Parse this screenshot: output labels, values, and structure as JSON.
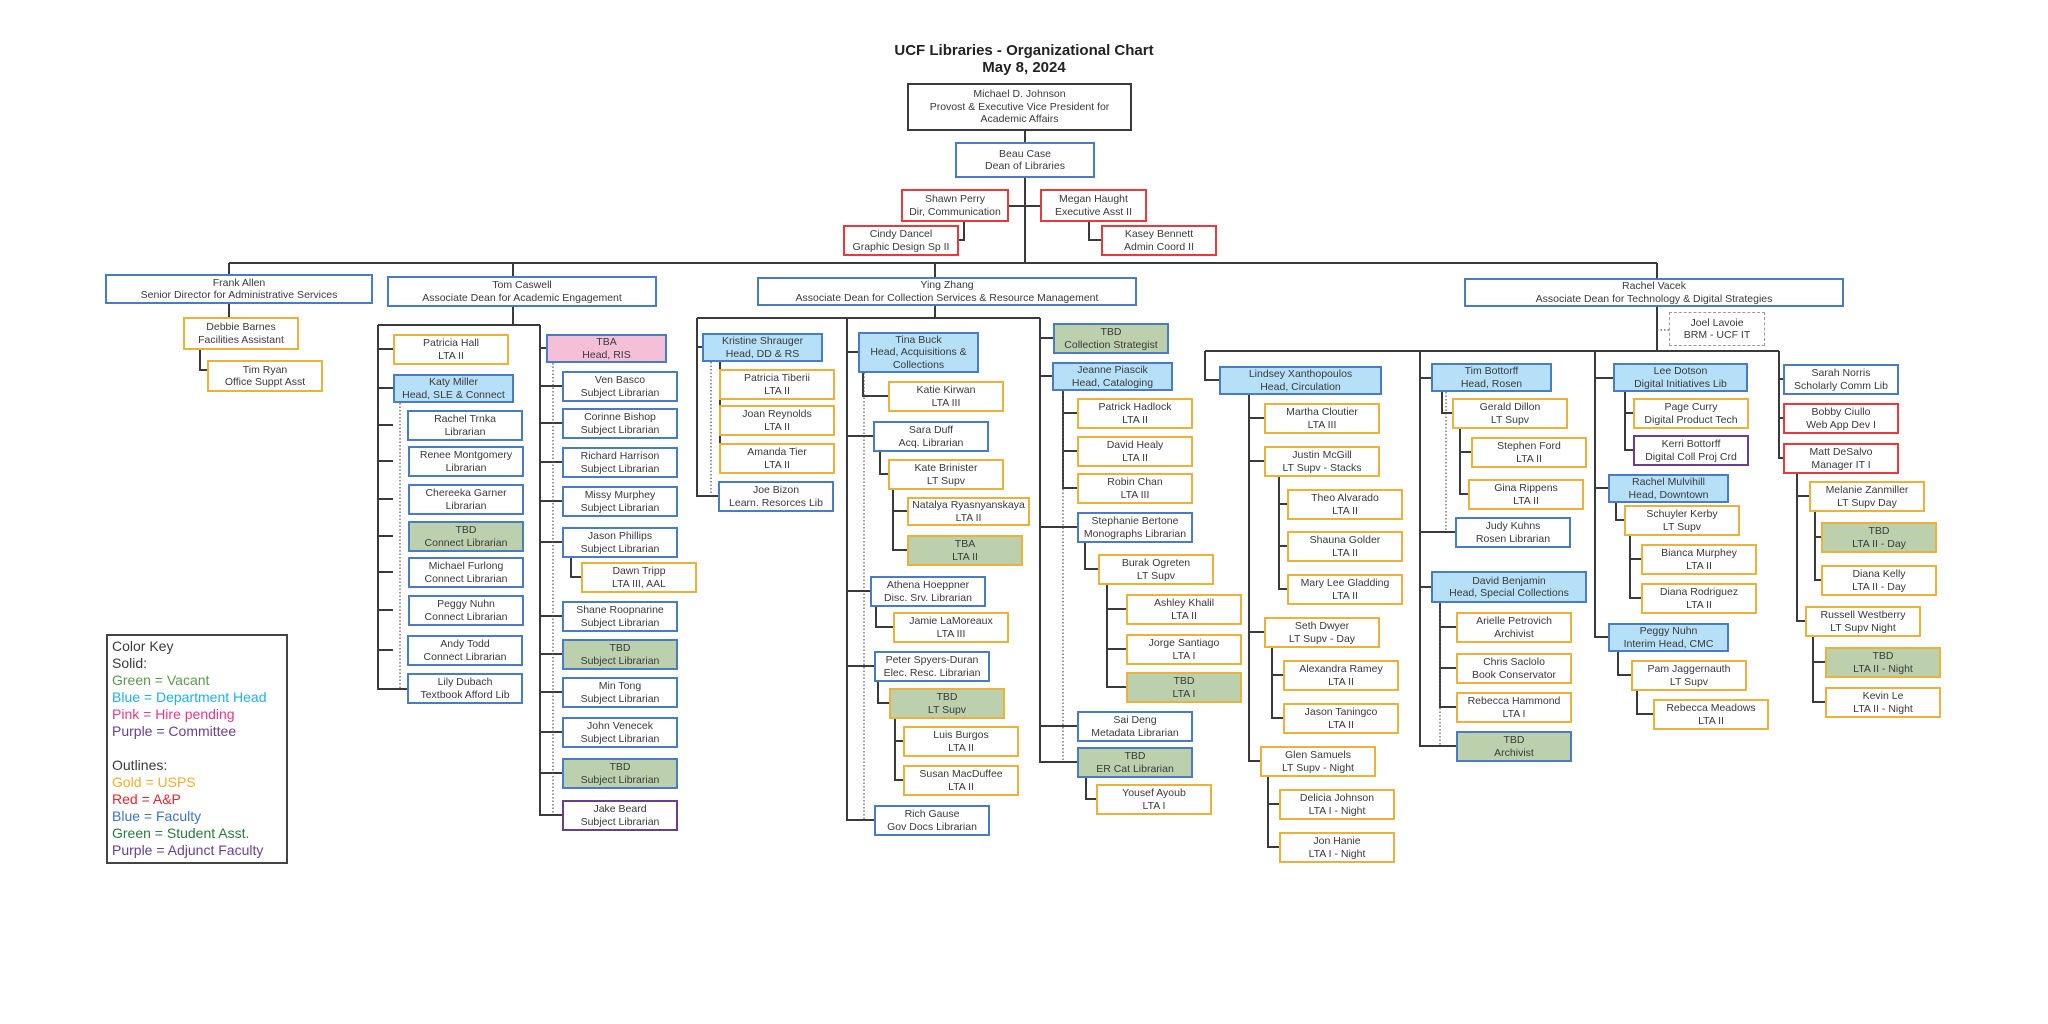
{
  "title": "UCF Libraries - Organizational Chart",
  "date": "May 8, 2024",
  "colors": {
    "faculty": "#4a7cc4",
    "usps": "#eab13b",
    "ap": "#e8393e",
    "adjunct": "#6a3f8f",
    "head_fill": "#b6e0f7",
    "vacant_fill": "#bcd0ae",
    "pending_fill": "#f6bfd8",
    "line": "#3a3a3a"
  },
  "nodes": {
    "johnson": {
      "name": "Michael D. Johnson",
      "title": "Provost & Executive Vice President for",
      "title2": "Academic Affairs"
    },
    "case": {
      "name": "Beau Case",
      "title": "Dean of Libraries"
    },
    "perry": {
      "name": "Shawn Perry",
      "title": "Dir, Communication"
    },
    "haught": {
      "name": "Megan Haught",
      "title": "Executive Asst II"
    },
    "dancel": {
      "name": "Cindy Dancel",
      "title": "Graphic Design Sp II"
    },
    "bennett": {
      "name": "Kasey Bennett",
      "title": "Admin Coord II"
    },
    "allen": {
      "name": "Frank Allen",
      "title": "Senior Director for Administrative Services"
    },
    "barnes": {
      "name": "Debbie Barnes",
      "title": "Facilities Assistant"
    },
    "ryan": {
      "name": "Tim Ryan",
      "title": "Office Suppt Asst"
    },
    "caswell": {
      "name": "Tom Caswell",
      "title": "Associate Dean for Academic Engagement"
    },
    "hall": {
      "name": "Patricia Hall",
      "title": "LTA II"
    },
    "miller": {
      "name": "Katy Miller",
      "title": "Head, SLE & Connect"
    },
    "trnka": {
      "name": "Rachel Trnka",
      "title": "Librarian"
    },
    "montgomery": {
      "name": "Renee Montgomery",
      "title": "Librarian"
    },
    "garner": {
      "name": "Chereeka Garner",
      "title": "Librarian"
    },
    "tbd_connect": {
      "name": "TBD",
      "title": "Connect Librarian"
    },
    "furlong": {
      "name": "Michael Furlong",
      "title": "Connect Librarian"
    },
    "nuhn_c": {
      "name": "Peggy Nuhn",
      "title": "Connect Librarian"
    },
    "todd": {
      "name": "Andy Todd",
      "title": "Connect Librarian"
    },
    "dubach": {
      "name": "Lily Dubach",
      "title": "Textbook Afford Lib"
    },
    "tba_ris": {
      "name": "TBA",
      "title": "Head, RIS"
    },
    "basco": {
      "name": "Ven Basco",
      "title": "Subject Librarian"
    },
    "bishop": {
      "name": "Corinne Bishop",
      "title": "Subject Librarian"
    },
    "harrison": {
      "name": "Richard Harrison",
      "title": "Subject Librarian"
    },
    "murphey_m": {
      "name": "Missy Murphey",
      "title": "Subject Librarian"
    },
    "phillips": {
      "name": "Jason Phillips",
      "title": "Subject Librarian"
    },
    "tripp": {
      "name": "Dawn Tripp",
      "title": "LTA III, AAL"
    },
    "roopnarine": {
      "name": "Shane Roopnarine",
      "title": "Subject Librarian"
    },
    "tbd_subj1": {
      "name": "TBD",
      "title": "Subject Librarian"
    },
    "tong": {
      "name": "Min Tong",
      "title": "Subject Librarian"
    },
    "venecek": {
      "name": "John Venecek",
      "title": "Subject Librarian"
    },
    "tbd_subj2": {
      "name": "TBD",
      "title": "Subject Librarian"
    },
    "beard": {
      "name": "Jake Beard",
      "title": "Subject Librarian"
    },
    "zhang": {
      "name": "Ying Zhang",
      "title": "Associate Dean for Collection Services & Resource Management"
    },
    "shrauger": {
      "name": "Kristine Shrauger",
      "title": "Head, DD & RS"
    },
    "tiberii": {
      "name": "Patricia Tiberii",
      "title": "LTA II"
    },
    "reynolds": {
      "name": "Joan Reynolds",
      "title": "LTA II"
    },
    "tier": {
      "name": "Amanda Tier",
      "title": "LTA II"
    },
    "bizon": {
      "name": "Joe Bizon",
      "title": "Learn. Resorces Lib"
    },
    "buck": {
      "name": "Tina Buck",
      "title": "Head, Acquisitions &",
      "title2": "Collections"
    },
    "kirwan": {
      "name": "Katie Kirwan",
      "title": "LTA III"
    },
    "duff": {
      "name": "Sara Duff",
      "title": "Acq. Librarian"
    },
    "brinister": {
      "name": "Kate Brinister",
      "title": "LT Supv"
    },
    "ryasnyanskaya": {
      "name": "Natalya Ryasnyanskaya",
      "title": "LTA II"
    },
    "tba_lta": {
      "name": "TBA",
      "title": "LTA II"
    },
    "hoeppner": {
      "name": "Athena Hoeppner",
      "title": "Disc. Srv. Librarian"
    },
    "lamoreaux": {
      "name": "Jamie LaMoreaux",
      "title": "LTA III"
    },
    "spyers": {
      "name": "Peter Spyers-Duran",
      "title": "Elec. Resc. Librarian"
    },
    "tbd_ltsupv": {
      "name": "TBD",
      "title": "LT Supv"
    },
    "burgos": {
      "name": "Luis Burgos",
      "title": "LTA II"
    },
    "macduffee": {
      "name": "Susan MacDuffee",
      "title": "LTA II"
    },
    "gause": {
      "name": "Rich Gause",
      "title": "Gov Docs Librarian"
    },
    "tbd_strategist": {
      "name": "TBD",
      "title": "Collection Strategist"
    },
    "piascik": {
      "name": "Jeanne Piascik",
      "title": "Head, Cataloging"
    },
    "hadlock": {
      "name": "Patrick Hadlock",
      "title": "LTA II"
    },
    "healy": {
      "name": "David Healy",
      "title": "LTA II"
    },
    "chan": {
      "name": "Robin Chan",
      "title": "LTA III"
    },
    "bertone": {
      "name": "Stephanie Bertone",
      "title": "Monographs Librarian"
    },
    "ogreten": {
      "name": "Burak Ogreten",
      "title": "LT Supv"
    },
    "khalil": {
      "name": "Ashley Khalil",
      "title": "LTA II"
    },
    "santiago": {
      "name": "Jorge Santiago",
      "title": "LTA I"
    },
    "tbd_lta1": {
      "name": "TBD",
      "title": "LTA I"
    },
    "deng": {
      "name": "Sai Deng",
      "title": "Metadata Librarian"
    },
    "tbd_ercat": {
      "name": "TBD",
      "title": "ER Cat Librarian"
    },
    "ayoub": {
      "name": "Yousef Ayoub",
      "title": "LTA I"
    },
    "vacek": {
      "name": "Rachel Vacek",
      "title": "Associate Dean for Technology & Digital Strategies"
    },
    "lavoie": {
      "name": "Joel Lavoie",
      "title": "BRM - UCF IT"
    },
    "xanthopoulos": {
      "name": "Lindsey Xanthopoulos",
      "title": "Head, Circulation"
    },
    "cloutier": {
      "name": "Martha Cloutier",
      "title": "LTA III"
    },
    "mcgill": {
      "name": "Justin McGill",
      "title": "LT Supv - Stacks"
    },
    "alvarado": {
      "name": "Theo Alvarado",
      "title": "LTA II"
    },
    "golder": {
      "name": "Shauna Golder",
      "title": "LTA II"
    },
    "gladding": {
      "name": "Mary Lee Gladding",
      "title": "LTA II"
    },
    "dwyer": {
      "name": "Seth Dwyer",
      "title": "LT Supv - Day"
    },
    "ramey": {
      "name": "Alexandra Ramey",
      "title": "LTA II"
    },
    "taningco": {
      "name": "Jason Taningco",
      "title": "LTA II"
    },
    "samuels": {
      "name": "Glen Samuels",
      "title": "LT Supv - Night"
    },
    "johnson_d": {
      "name": "Delicia Johnson",
      "title": "LTA I - Night"
    },
    "hanie": {
      "name": "Jon Hanie",
      "title": "LTA I - Night"
    },
    "bottorff_t": {
      "name": "Tim Bottorff",
      "title": "Head, Rosen"
    },
    "dillon": {
      "name": "Gerald Dillon",
      "title": "LT Supv"
    },
    "ford": {
      "name": "Stephen Ford",
      "title": "LTA II"
    },
    "rippens": {
      "name": "Gina Rippens",
      "title": "LTA II"
    },
    "kuhns": {
      "name": "Judy Kuhns",
      "title": "Rosen Librarian"
    },
    "benjamin": {
      "name": "David Benjamin",
      "title": "Head, Special Collections"
    },
    "petrovich": {
      "name": "Arielle Petrovich",
      "title": "Archivist"
    },
    "saclolo": {
      "name": "Chris Saclolo",
      "title": "Book Conservator"
    },
    "hammond": {
      "name": "Rebecca Hammond",
      "title": "LTA I"
    },
    "tbd_archivist": {
      "name": "TBD",
      "title": "Archivist"
    },
    "dotson": {
      "name": "Lee Dotson",
      "title": "Digital Initiatives Lib"
    },
    "curry": {
      "name": "Page Curry",
      "title": "Digital Product Tech"
    },
    "bottorff_k": {
      "name": "Kerri Bottorff",
      "title": "Digital Coll Proj Crd"
    },
    "mulvihill": {
      "name": "Rachel Mulvihill",
      "title": "Head, Downtown"
    },
    "kerby": {
      "name": "Schuyler Kerby",
      "title": "LT Supv"
    },
    "murphey_b": {
      "name": "Bianca Murphey",
      "title": "LTA II"
    },
    "rodriguez": {
      "name": "Diana Rodriguez",
      "title": "LTA II"
    },
    "nuhn_cmc": {
      "name": "Peggy Nuhn",
      "title": "Interim Head, CMC"
    },
    "jaggernauth": {
      "name": "Pam Jaggernauth",
      "title": "LT Supv"
    },
    "meadows": {
      "name": "Rebecca Meadows",
      "title": "LTA II"
    },
    "norris": {
      "name": "Sarah Norris",
      "title": "Scholarly Comm Lib"
    },
    "ciullo": {
      "name": "Bobby Ciullo",
      "title": "Web App Dev I"
    },
    "desalvo": {
      "name": "Matt DeSalvo",
      "title": "Manager IT I"
    },
    "zanmiller": {
      "name": "Melanie Zanmiller",
      "title": "LT Supv Day"
    },
    "tbd_day": {
      "name": "TBD",
      "title": "LTA II - Day"
    },
    "kelly": {
      "name": "Diana Kelly",
      "title": "LTA II - Day"
    },
    "westberry": {
      "name": "Russell Westberry",
      "title": "LT Supv Night"
    },
    "tbd_night": {
      "name": "TBD",
      "title": "LTA II - Night"
    },
    "le": {
      "name": "Kevin Le",
      "title": "LTA II - Night"
    }
  },
  "legend": {
    "heading": "Color Key",
    "solid_heading": "Solid:",
    "solid": [
      {
        "label": "Green = Vacant",
        "color": "#5a9a4a"
      },
      {
        "label": "Blue = Department Head",
        "color": "#1fb0e6"
      },
      {
        "label": "Pink = Hire pending",
        "color": "#e6388f"
      },
      {
        "label": "Purple = Committee",
        "color": "#6a3f8f"
      }
    ],
    "outline_heading": "Outlines:",
    "outlines": [
      {
        "label": "Gold = USPS",
        "color": "#f0ae2a"
      },
      {
        "label": "Red = A&P",
        "color": "#e8262d"
      },
      {
        "label": "Blue = Faculty",
        "color": "#3f74c2"
      },
      {
        "label": "Green = Student Asst.",
        "color": "#2a7a3a"
      },
      {
        "label": "Purple = Adjunct Faculty",
        "color": "#6a3f8f"
      }
    ]
  }
}
